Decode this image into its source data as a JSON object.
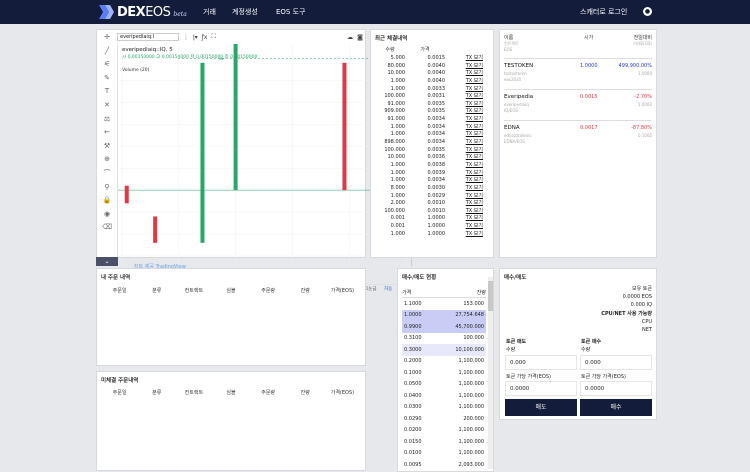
{
  "nav": {
    "logo_dex": "DEX",
    "logo_eos": "EOS",
    "logo_beta": "beta",
    "items": [
      "거래",
      "계정생성",
      "EOS 도구"
    ],
    "login": "스캐터로 로그인",
    "user_icon": "user-icon"
  },
  "chart": {
    "symbol": "everipediaiq:I",
    "interval": "5",
    "legend_title": "everipediaiq::IQ, 5",
    "ohlc": "시 0.00150000 고 0.00150000 저 0.00150000 종 0.00150000",
    "volume_label": "Volume (20)",
    "yticks": [
      "0.00450000",
      "0.00400000",
      "0.00350000",
      "0.00300000",
      "0.00250000",
      "0.00200000",
      "0.00150000",
      "0.00100000",
      "0.00050000",
      "0.00000000"
    ],
    "price_tag": "0.00150000",
    "xticks": [
      "6:00",
      "07:00",
      "08:00",
      "09:00",
      "10:00",
      "11:00"
    ],
    "watermark": "차트 제공 TradingView",
    "bottom_range": "기간",
    "bottom_time": "00:45:03 (UTC)",
    "bottom_pct": "%",
    "bottom_log": "로그눈금",
    "bottom_auto": "자동",
    "collapse_icon": "chevron-down-icon",
    "colors": {
      "up": "#2aa56b",
      "down": "#e23845"
    },
    "chart_data": {
      "type": "candlestick",
      "x": [
        "06:05",
        "06:35",
        "07:25",
        "07:45",
        "08:00",
        "09:55"
      ],
      "candles": [
        {
          "open": 0.0016,
          "close": 0.0012,
          "high": 0.0016,
          "low": 0.0012
        },
        {
          "open": 0.0009,
          "close": 0.0003,
          "high": 0.0009,
          "low": 0.0003
        },
        {
          "open": 0.0003,
          "close": 0.0044,
          "high": 0.0044,
          "low": 0.0003
        },
        {
          "open": 0.0045,
          "close": 0.0045,
          "high": 0.0045,
          "low": 0.0044
        },
        {
          "open": 0.0015,
          "close": 0.0049,
          "high": 0.0049,
          "low": 0.0015
        },
        {
          "open": 0.0044,
          "close": 0.0015,
          "high": 0.0044,
          "low": 0.0015
        }
      ],
      "ylim": [
        0,
        0.0046
      ]
    }
  },
  "trade_history": {
    "title": "최근 체결내역",
    "headers": {
      "qty": "수량",
      "price": "가격",
      "tx": ""
    },
    "rows": [
      [
        "5.000",
        "0.0015",
        "TX 보기"
      ],
      [
        "80.000",
        "0.0040",
        "TX 보기"
      ],
      [
        "10.000",
        "0.0040",
        "TX 보기"
      ],
      [
        "1.000",
        "0.0040",
        "TX 보기"
      ],
      [
        "1.000",
        "0.0033",
        "TX 보기"
      ],
      [
        "100.000",
        "0.0031",
        "TX 보기"
      ],
      [
        "91.000",
        "0.0035",
        "TX 보기"
      ],
      [
        "909.000",
        "0.0035",
        "TX 보기"
      ],
      [
        "91.000",
        "0.0034",
        "TX 보기"
      ],
      [
        "1.000",
        "0.0034",
        "TX 보기"
      ],
      [
        "1.000",
        "0.0034",
        "TX 보기"
      ],
      [
        "898.000",
        "0.0034",
        "TX 보기"
      ],
      [
        "100.000",
        "0.0035",
        "TX 보기"
      ],
      [
        "10.000",
        "0.0036",
        "TX 보기"
      ],
      [
        "1.000",
        "0.0038",
        "TX 보기"
      ],
      [
        "1.000",
        "0.0039",
        "TX 보기"
      ],
      [
        "1.000",
        "0.0034",
        "TX 보기"
      ],
      [
        "8.000",
        "0.0030",
        "TX 보기"
      ],
      [
        "1.000",
        "0.0029",
        "TX 보기"
      ],
      [
        "2.000",
        "0.0010",
        "TX 보기"
      ],
      [
        "100.000",
        "0.0010",
        "TX 보기"
      ],
      [
        "0.001",
        "1.0000",
        "TX 보기"
      ],
      [
        "0.001",
        "1.0000",
        "TX 보기"
      ],
      [
        "1.000",
        "1.0000",
        "TX 보기"
      ]
    ]
  },
  "tokens": {
    "headers": {
      "name": "이름",
      "sub1": "컨트랙트",
      "sub2": "EOS",
      "price": "시가",
      "change": "전일대비",
      "volume": "거래(EOS)"
    },
    "items": [
      {
        "name": "TESTOKEN",
        "contract": "testosteron",
        "pair": "eos2020",
        "price": "1.0000",
        "change": "499,900.00%",
        "volume": "1.0000",
        "color": "#2a37d8"
      },
      {
        "name": "Everipedia",
        "contract": "everipediaiq",
        "pair": "IQ/EOS",
        "price": "0.0015",
        "change": "-2.70%",
        "volume": "1.0000",
        "color": "#e23845"
      },
      {
        "name": "EDNA",
        "contract": "ednazztokens",
        "pair": "EDNA/EOS",
        "price": "0.0017",
        "change": "-87.80%",
        "volume": "0.1000",
        "color": "#e23845"
      }
    ]
  },
  "my_orders": {
    "title": "내 주문 내역",
    "headers": [
      "주문일",
      "분류",
      "컨트랙트",
      "심볼",
      "주문량",
      "잔량",
      "가격(EOS)"
    ]
  },
  "pending_orders": {
    "title": "미체결 주문내역",
    "headers": [
      "주문일",
      "분류",
      "컨트랙트",
      "심볼",
      "주문량",
      "잔량",
      "가격(EOS)"
    ]
  },
  "orderbook": {
    "title": "매수/매도 현황",
    "headers": {
      "price": "가격",
      "qty": "잔량"
    },
    "rows": [
      {
        "price": "1.1000",
        "qty": "153.000",
        "side": "none"
      },
      {
        "price": "1.0000",
        "qty": "27,754.648",
        "side": "sell"
      },
      {
        "price": "0.9900",
        "qty": "45,700.000",
        "side": "sell"
      },
      {
        "price": "0.3100",
        "qty": "100.000",
        "side": "none"
      },
      {
        "price": "0.3000",
        "qty": "10,100.000",
        "side": "sell-light"
      },
      {
        "price": "0.2000",
        "qty": "1,100.000",
        "side": "none"
      },
      {
        "price": "0.1000",
        "qty": "1,100.000",
        "side": "none"
      },
      {
        "price": "0.0500",
        "qty": "1,100.000",
        "side": "none"
      },
      {
        "price": "0.0400",
        "qty": "1,100.000",
        "side": "none"
      },
      {
        "price": "0.0300",
        "qty": "1,100.000",
        "side": "none"
      },
      {
        "price": "0.0290",
        "qty": "200.000",
        "side": "none"
      },
      {
        "price": "0.0200",
        "qty": "1,100.000",
        "side": "none"
      },
      {
        "price": "0.0150",
        "qty": "1,100.000",
        "side": "none"
      },
      {
        "price": "0.0100",
        "qty": "1,100.000",
        "side": "none"
      },
      {
        "price": "0.0095",
        "qty": "2,093.000",
        "side": "none"
      }
    ],
    "colors": {
      "sell": "#c9cdf5",
      "sell_light": "#e7e9fb"
    }
  },
  "buysell": {
    "title": "매수/매도",
    "balance_label": "보유 토큰",
    "balance_eos": "0.0000 EOS",
    "balance_iq": "0.000 IQ",
    "cpu_net": "CPU/NET 사용 가능량",
    "cpu": "CPU",
    "net": "NET",
    "sell_title": "토큰 매도",
    "buy_title": "토큰 매수",
    "qty_label": "수량",
    "sell_qty": "0.000",
    "buy_qty": "0.000",
    "price_label": "토큰 가당 가격(EOS)",
    "sell_price": "0.0000",
    "buy_price": "0.0000",
    "sell_button": "매도",
    "buy_button": "매수"
  }
}
